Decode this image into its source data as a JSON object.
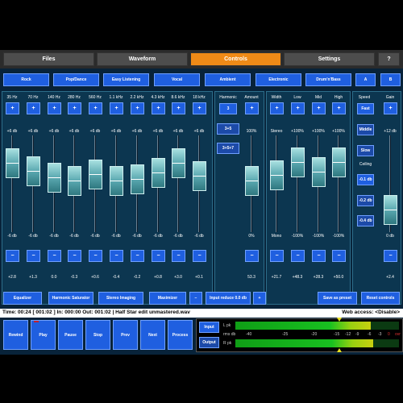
{
  "tabs": [
    {
      "label": "Files"
    },
    {
      "label": "Waveform"
    },
    {
      "label": "Controls"
    },
    {
      "label": "Settings"
    },
    {
      "label": "?"
    }
  ],
  "presets": [
    {
      "label": "Rock"
    },
    {
      "label": "Pop/Dance"
    },
    {
      "label": "Easy Listening"
    },
    {
      "label": "Vocal"
    },
    {
      "label": "Ambient"
    },
    {
      "label": "Electronic"
    },
    {
      "label": "Drum'n'Bass"
    },
    {
      "label": "A"
    },
    {
      "label": "B"
    }
  ],
  "eq": {
    "bands": [
      {
        "freq": "35 Hz",
        "max": "+6 db",
        "min": "-6 db",
        "value": "+2.8",
        "level": 0.27
      },
      {
        "freq": "70 Hz",
        "max": "+6 db",
        "min": "-6 db",
        "value": "+1.3",
        "level": 0.36
      },
      {
        "freq": "140 Hz",
        "max": "+6 db",
        "min": "-6 db",
        "value": "0.0",
        "level": 0.44
      },
      {
        "freq": "280 Hz",
        "max": "+6 db",
        "min": "-6 db",
        "value": "-0.3",
        "level": 0.47
      },
      {
        "freq": "560 Hz",
        "max": "+6 db",
        "min": "-6 db",
        "value": "+0.6",
        "level": 0.4
      },
      {
        "freq": "1.1 kHz",
        "max": "+6 db",
        "min": "-6 db",
        "value": "-0.4",
        "level": 0.47
      },
      {
        "freq": "2.2 kHz",
        "max": "+6 db",
        "min": "-6 db",
        "value": "-0.2",
        "level": 0.45
      },
      {
        "freq": "4.3 kHz",
        "max": "+6 db",
        "min": "-6 db",
        "value": "+0.8",
        "level": 0.38
      },
      {
        "freq": "8.6 kHz",
        "max": "+6 db",
        "min": "-6 db",
        "value": "+3.0",
        "level": 0.27
      },
      {
        "freq": "18 kHz",
        "max": "+6 db",
        "min": "-6 db",
        "value": "+0.1",
        "level": 0.42
      }
    ],
    "plus": "+",
    "minus": "−"
  },
  "harmonic": {
    "label": "Harmonic",
    "options": [
      {
        "label": "3"
      },
      {
        "label": "3+5"
      },
      {
        "label": "3+5+7"
      }
    ]
  },
  "amount": {
    "label": "Amount",
    "max": "100%",
    "min": "0%",
    "value": "53.3",
    "level": 0.47
  },
  "stereo": [
    {
      "label": "Width",
      "max": "Stereo",
      "min": "Mono",
      "value": "+21.7",
      "level": 0.41
    },
    {
      "label": "Low",
      "max": "+100%",
      "min": "-100%",
      "value": "+48.3",
      "level": 0.26
    },
    {
      "label": "Mid",
      "max": "+100%",
      "min": "-100%",
      "value": "+28.3",
      "level": 0.37
    },
    {
      "label": "High",
      "max": "+100%",
      "min": "-100%",
      "value": "+50.0",
      "level": 0.26
    }
  ],
  "speed": {
    "label": "Speed",
    "options": [
      {
        "label": "Fast"
      },
      {
        "label": "Middle"
      },
      {
        "label": "Slow"
      }
    ],
    "ceiling_label": "Ceiling",
    "ceilings": [
      {
        "label": "-0.1 db"
      },
      {
        "label": "-0.2 db"
      },
      {
        "label": "-0.4 db"
      }
    ]
  },
  "gain": {
    "label": "Gain",
    "max": "+12 db",
    "min": "0 db",
    "value": "+2.4",
    "level": 0.8
  },
  "bottom_buttons": {
    "equalizer": "Equalizer",
    "harmonic_saturator": "Harmonic Saturator",
    "stereo_imaging": "Stereo Imaging",
    "maximizer": "Maximizer",
    "minus": "−",
    "input_reduce": "Input reduce 0.0 db",
    "plus": "+",
    "save_preset": "Save as preset",
    "reset": "Reset controls"
  },
  "status": {
    "text": "Time: 00:24  [ 001:02 ]  In: 000:00  Out: 001:02  |  Half Star edit unmastered.wav",
    "web_access": "Web access: <Disable>"
  },
  "transport": [
    {
      "label": "Rewind"
    },
    {
      "label": "Play"
    },
    {
      "label": "Pause"
    },
    {
      "label": "Stop"
    },
    {
      "label": "Prev"
    },
    {
      "label": "Next"
    },
    {
      "label": "Process"
    }
  ],
  "meter": {
    "input_label": "Input",
    "output_label": "Output",
    "left_label": "L pk",
    "rms_label": "rms db",
    "right_label": "R pk",
    "scale": [
      "-40",
      "-25",
      "-20",
      "-15",
      "-12",
      "-9",
      "-6",
      "-3",
      "0",
      "ovr"
    ],
    "left_fill": 0.83,
    "right_fill": 0.84
  },
  "colors": {
    "accent": "#ef8a17",
    "button": "#1f5fe0",
    "panel": "#0c3650",
    "handle": "#5aa8b0"
  }
}
